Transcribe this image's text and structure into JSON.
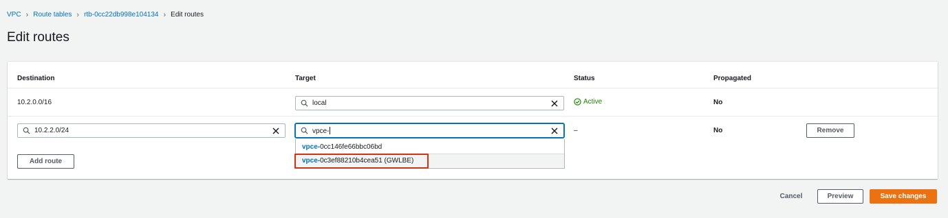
{
  "breadcrumb": {
    "vpc": "VPC",
    "route_tables": "Route tables",
    "route_table_id": "rtb-0cc22db998e104134",
    "current": "Edit routes"
  },
  "page_title": "Edit routes",
  "table": {
    "headers": {
      "destination": "Destination",
      "target": "Target",
      "status": "Status",
      "propagated": "Propagated"
    },
    "row1": {
      "destination": "10.2.0.0/16",
      "target": "local",
      "status": "Active",
      "propagated": "No"
    },
    "row2": {
      "destination": "10.2.2.0/24",
      "target": "vpce-",
      "status": "–",
      "propagated": "No",
      "remove_label": "Remove"
    },
    "add_route_label": "Add route"
  },
  "dropdown": {
    "options": [
      {
        "match": "vpce-",
        "rest": "0cc146fe66bbc06bd"
      },
      {
        "match": "vpce-",
        "rest": "0c3ef88210b4cea51 (GWLBE)"
      }
    ],
    "highlighted_index": 1
  },
  "footer": {
    "cancel_label": "Cancel",
    "preview_label": "Preview",
    "save_label": "Save changes"
  },
  "colors": {
    "link": "#0073bb",
    "active": "#1d8102",
    "primary": "#ec7211",
    "highlight_box": "#d13212"
  },
  "icons": {
    "breadcrumb_separator": "chevron-right-icon",
    "search": "search-icon",
    "clear": "close-icon",
    "status": "check-circle-icon"
  }
}
